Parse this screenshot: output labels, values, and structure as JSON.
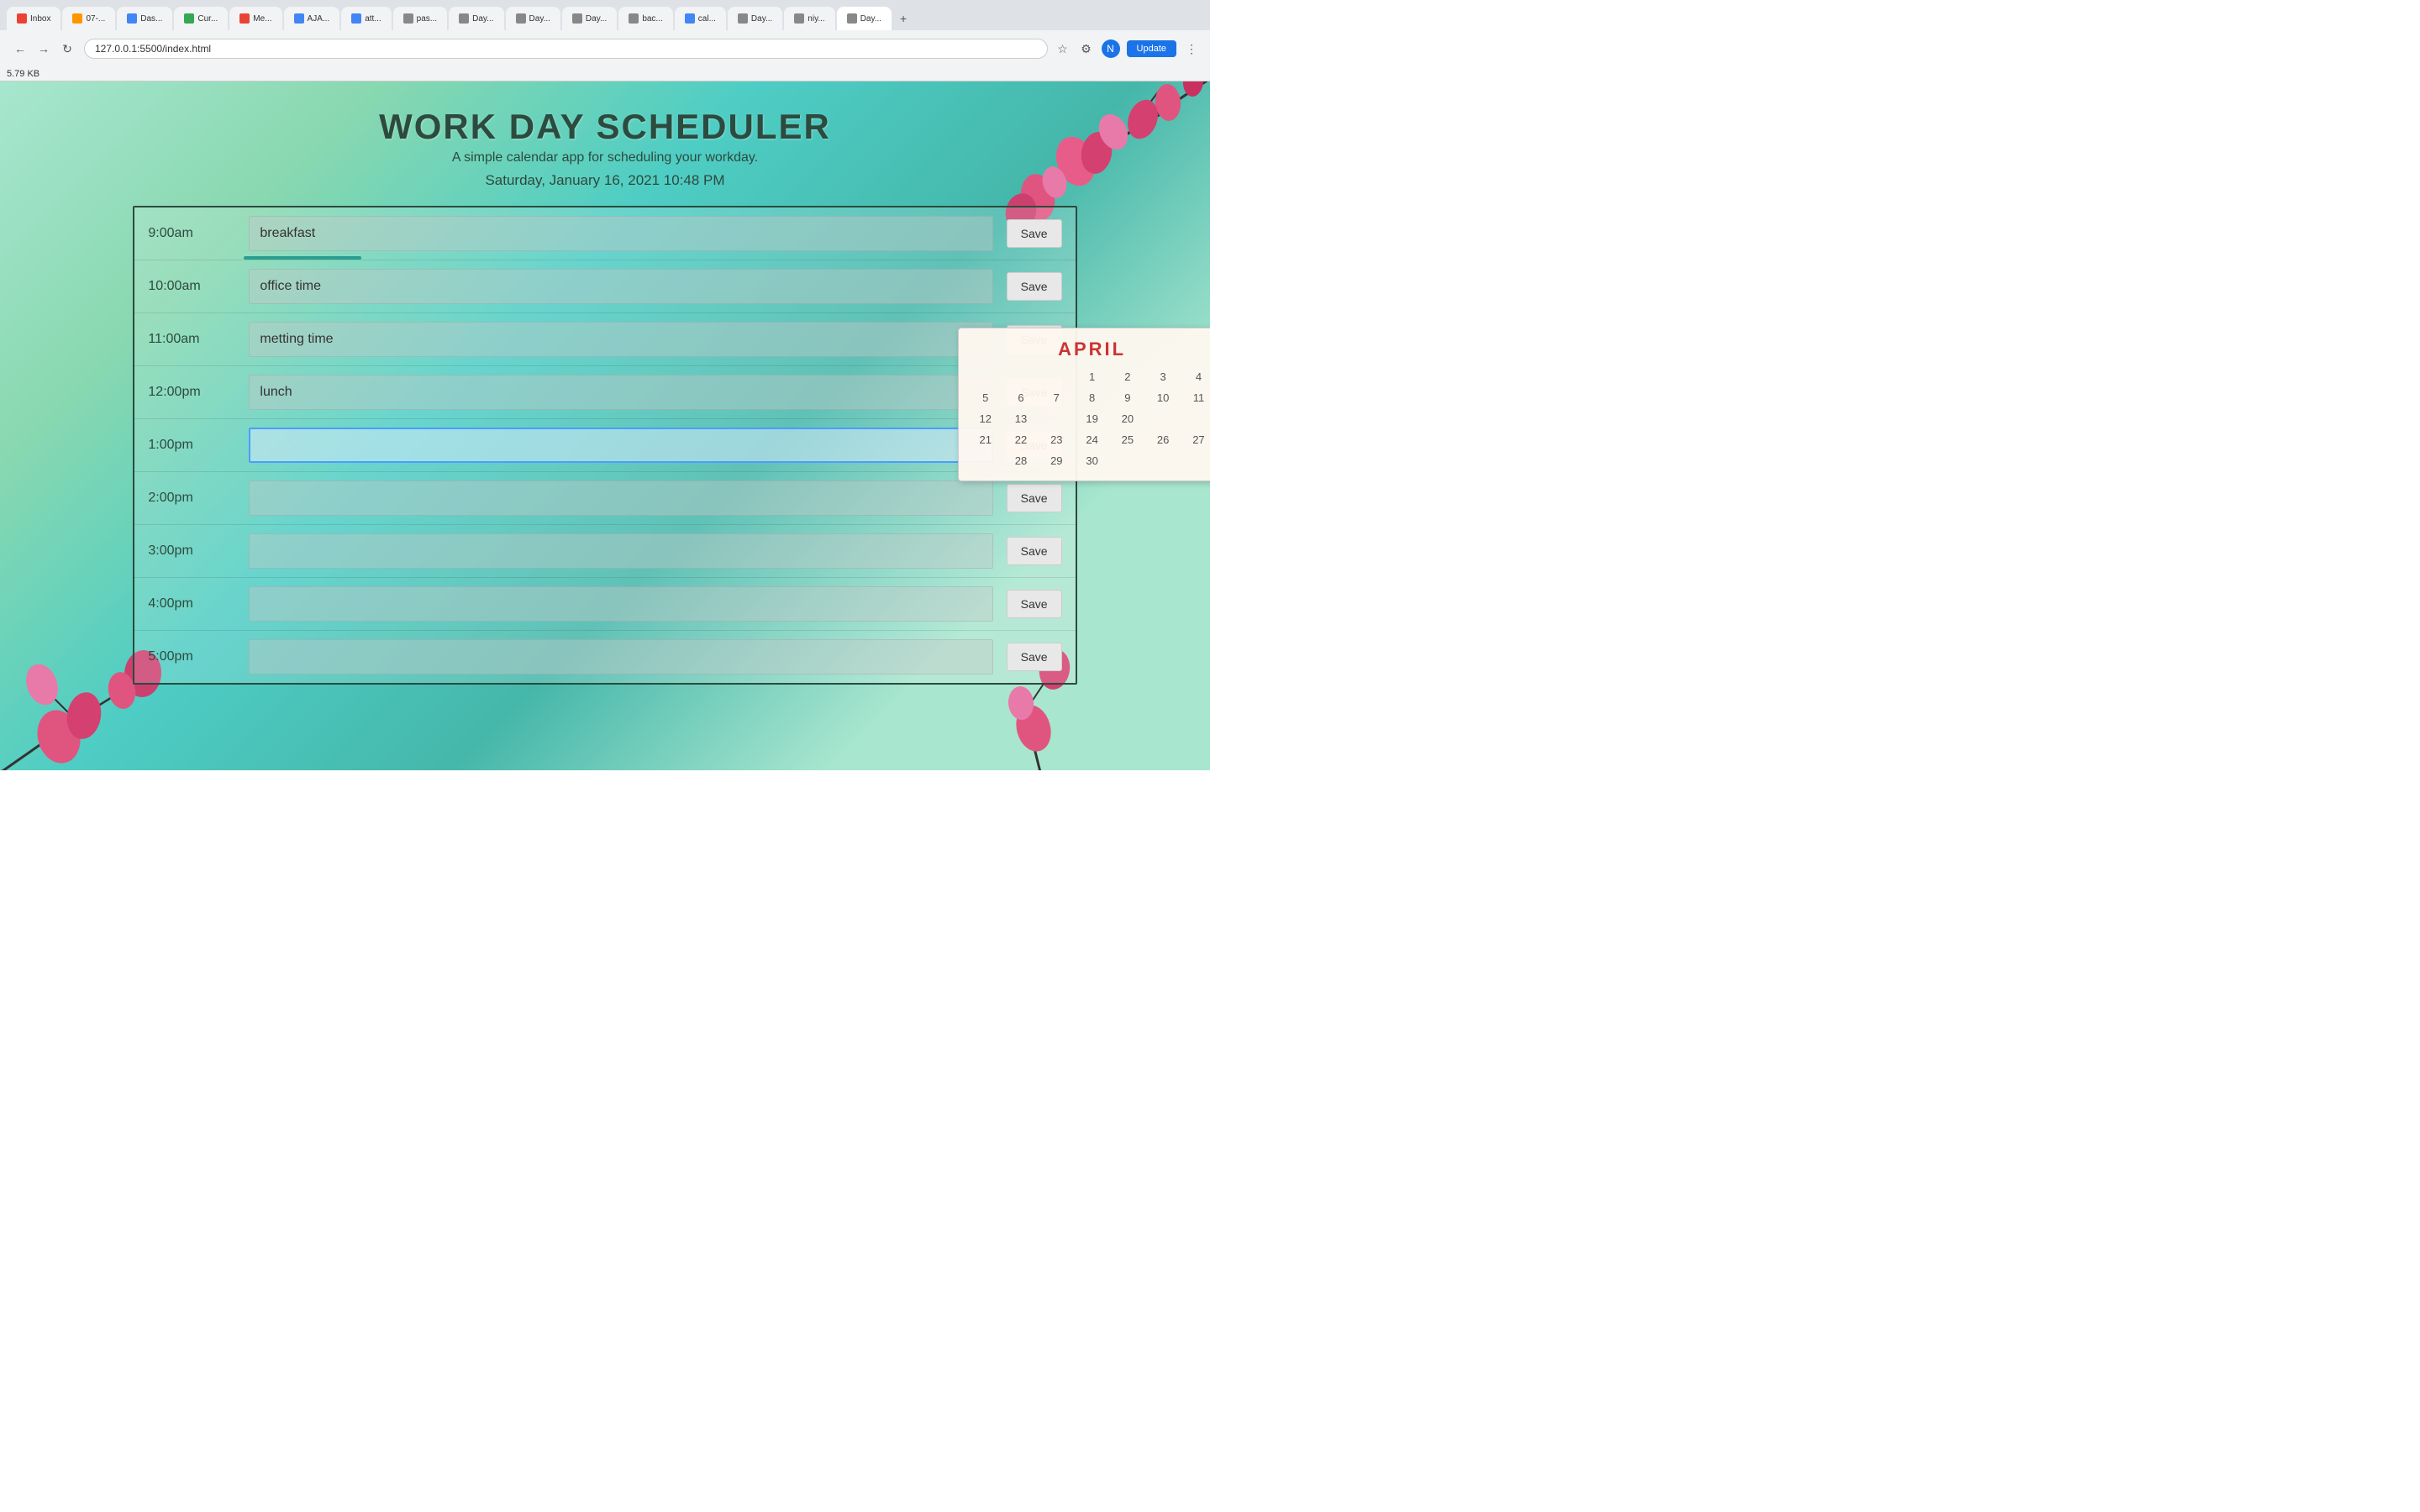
{
  "browser": {
    "url": "127.0.0.1:5500/index.html",
    "file_size": "5.79 KB",
    "update_btn": "Update",
    "tabs": [
      {
        "label": "Inbox",
        "active": false,
        "favicon_color": "#ea4335"
      },
      {
        "label": "07-...",
        "active": false,
        "favicon_color": "#ff9500"
      },
      {
        "label": "Das...",
        "active": false,
        "favicon_color": "#4285f4"
      },
      {
        "label": "Cur...",
        "active": false,
        "favicon_color": "#34a853"
      },
      {
        "label": "Me...",
        "active": false,
        "favicon_color": "#ea4335"
      },
      {
        "label": "AJA...",
        "active": false,
        "favicon_color": "#4285f4"
      },
      {
        "label": "att...",
        "active": false,
        "favicon_color": "#4285f4"
      },
      {
        "label": "pas...",
        "active": false,
        "favicon_color": "#555"
      },
      {
        "label": "Day...",
        "active": false,
        "favicon_color": "#555"
      },
      {
        "label": "Day...",
        "active": false,
        "favicon_color": "#555"
      },
      {
        "label": "Day...",
        "active": false,
        "favicon_color": "#555"
      },
      {
        "label": "bac...",
        "active": false,
        "favicon_color": "#555"
      },
      {
        "label": "cal...",
        "active": false,
        "favicon_color": "#4285f4"
      },
      {
        "label": "Day...",
        "active": false,
        "favicon_color": "#555"
      },
      {
        "label": "niy...",
        "active": false,
        "favicon_color": "#555"
      },
      {
        "label": "Day...",
        "active": true,
        "favicon_color": "#555"
      }
    ]
  },
  "app": {
    "title": "WORK DAY SCHEDULER",
    "subtitle": "A simple calendar app for scheduling your workday.",
    "datetime": "Saturday, January 16, 2021 10:48 PM"
  },
  "schedule": {
    "rows": [
      {
        "time": "9:00am",
        "value": "breakfast",
        "active": false
      },
      {
        "time": "10:00am",
        "value": "office time",
        "active": false
      },
      {
        "time": "11:00am",
        "value": "metting time",
        "active": false
      },
      {
        "time": "12:00pm",
        "value": "lunch",
        "active": false
      },
      {
        "time": "1:00pm",
        "value": "",
        "active": true
      },
      {
        "time": "2:00pm",
        "value": "",
        "active": false
      },
      {
        "time": "3:00pm",
        "value": "",
        "active": false
      },
      {
        "time": "4:00pm",
        "value": "",
        "active": false
      },
      {
        "time": "5:00pm",
        "value": "",
        "active": false
      }
    ],
    "save_label": "Save"
  },
  "calendar": {
    "month": "APRIL",
    "days": [
      {
        "num": "",
        "empty": true
      },
      {
        "num": "",
        "empty": true
      },
      {
        "num": "",
        "empty": true
      },
      {
        "num": "1"
      },
      {
        "num": "2"
      },
      {
        "num": "3"
      },
      {
        "num": "4"
      },
      {
        "num": "5"
      },
      {
        "num": "6"
      },
      {
        "num": "7"
      },
      {
        "num": "8"
      },
      {
        "num": "9"
      },
      {
        "num": "10"
      },
      {
        "num": "11"
      },
      {
        "num": "12"
      },
      {
        "num": "13"
      },
      {
        "num": "",
        "empty": true
      },
      {
        "num": "19"
      },
      {
        "num": "20"
      },
      {
        "num": "",
        "empty": true
      },
      {
        "num": "",
        "empty": true
      },
      {
        "num": "21"
      },
      {
        "num": "22"
      },
      {
        "num": "23"
      },
      {
        "num": "24"
      },
      {
        "num": "25"
      },
      {
        "num": "26"
      },
      {
        "num": "27"
      },
      {
        "num": "",
        "empty": true
      },
      {
        "num": "28"
      },
      {
        "num": "29"
      },
      {
        "num": "30"
      }
    ]
  }
}
